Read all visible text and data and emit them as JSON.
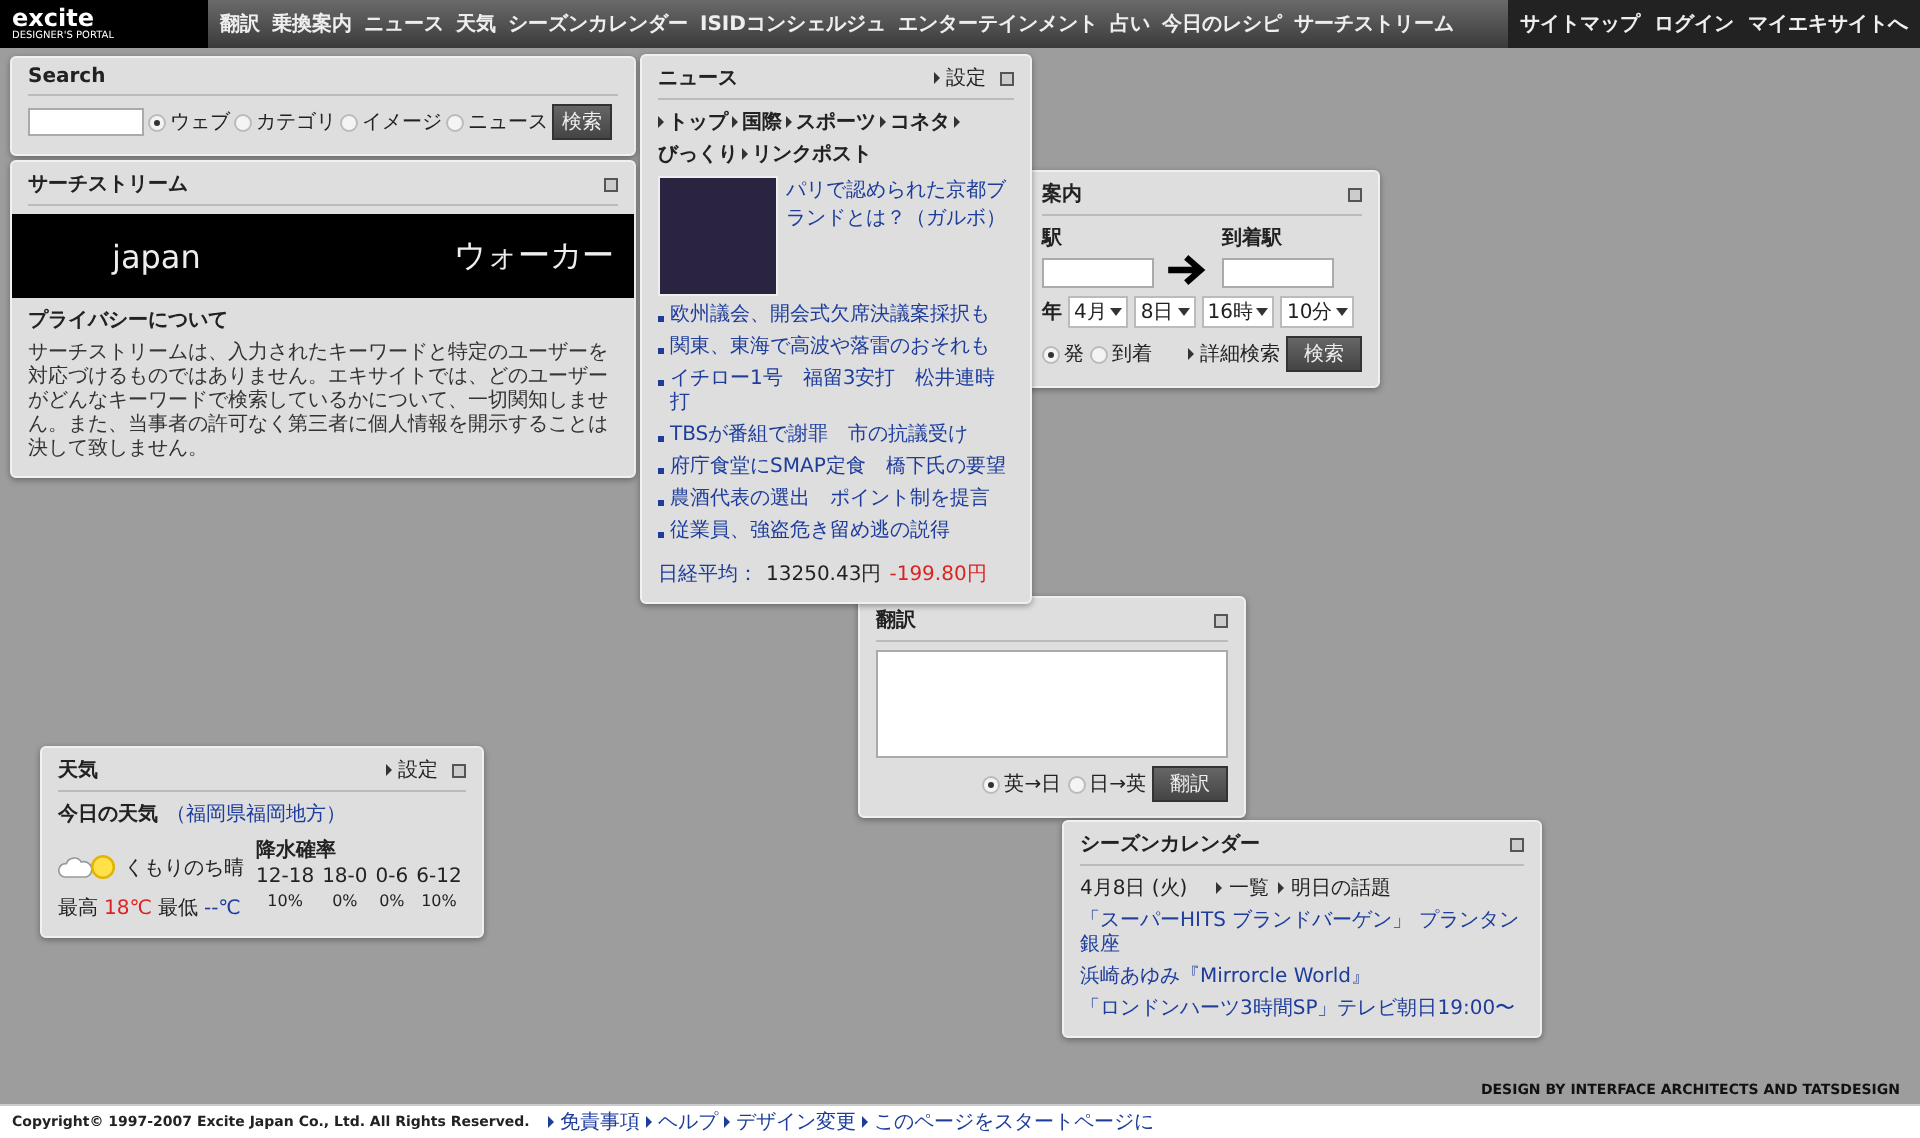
{
  "top_nav": {
    "logo": "excite",
    "logo_sub": "DESIGNER'S PORTAL",
    "items": [
      "翻訳",
      "乗換案内",
      "ニュース",
      "天気",
      "シーズンカレンダー",
      "ISIDコンシェルジュ",
      "エンターテインメント",
      "占い",
      "今日のレシピ",
      "サーチストリーム"
    ],
    "right_items": [
      "サイトマップ",
      "ログイン",
      "マイエキサイトへ"
    ]
  },
  "search": {
    "title": "Search",
    "options": [
      {
        "label": "ウェブ",
        "selected": true
      },
      {
        "label": "カテゴリ",
        "selected": false
      },
      {
        "label": "イメージ",
        "selected": false
      },
      {
        "label": "ニュース",
        "selected": false
      }
    ],
    "button": "検索"
  },
  "search_stream": {
    "title": "サーチストリーム",
    "words": [
      "japan",
      "ウォーカー"
    ],
    "privacy_title": "プライバシーについて",
    "privacy_text": "サーチストリームは、入力されたキーワードと特定のユーザーを対応づけるものではありません。エキサイトでは、どのユーザーがどんなキーワードで検索しているかについて、一切関知しません。また、当事者の許可なく第三者に個人情報を開示することは決して致しません。"
  },
  "news": {
    "title": "ニュース",
    "settings": "設定",
    "tabs": [
      "トップ",
      "国際",
      "スポーツ",
      "コネタ",
      "びっくり",
      "リンクポスト"
    ],
    "feature": "パリで認められた京都ブランドとは？（ガルボ）",
    "headlines": [
      "欧州議会、開会式欠席決議案採択も",
      "関東、東海で高波や落雷のおそれも",
      "イチロー1号　福留3安打　松井連時打",
      "TBSが番組で謝罪　市の抗議受け",
      "府庁食堂にSMAP定食　橋下氏の要望",
      "農酒代表の選出　ポイント制を提言",
      "従業員、強盗危き留め逃の説得"
    ],
    "nikkei_label": "日経平均：",
    "nikkei_value": "13250.43円",
    "nikkei_change": "-199.80円"
  },
  "transit": {
    "title": "案内",
    "from_label": "駅",
    "to_label": "到着駅",
    "date_label": "年",
    "selects": [
      "4月",
      "8日",
      "16時",
      "10分"
    ],
    "options": [
      {
        "label": "発",
        "selected": true
      },
      {
        "label": "到着",
        "selected": false
      }
    ],
    "detail_link": "詳細検索",
    "button": "検索"
  },
  "translate": {
    "title": "翻訳",
    "options": [
      {
        "label": "英→日",
        "selected": true
      },
      {
        "label": "日→英",
        "selected": false
      }
    ],
    "button": "翻訳"
  },
  "weather": {
    "title": "天気",
    "settings": "設定",
    "today_label": "今日の天気",
    "region": "（福岡県福岡地方）",
    "condition": "くもりのち晴",
    "rain_label": "降水確率",
    "periods": [
      "12-18",
      "18-0",
      "0-6",
      "6-12"
    ],
    "chances": [
      "10%",
      "0%",
      "0%",
      "10%"
    ],
    "high_label": "最高",
    "high": "18℃",
    "low_label": "最低",
    "low": "--℃"
  },
  "season": {
    "title": "シーズンカレンダー",
    "date": "4月8日 (火)",
    "links": [
      "一覧",
      "明日の話題"
    ],
    "items": [
      "「スーパーHITS ブランドバーゲン」 プランタン銀座",
      "浜崎あゆみ『Mirrorcle World』",
      "「ロンドンハーツ3時間SP」テレビ朝日19:00〜"
    ]
  },
  "credit": "DESIGN BY INTERFACE ARCHITECTS AND TATSDESIGN",
  "footer": {
    "copyright": "Copyright© 1997-2007 Excite Japan Co., Ltd. All Rights Reserved.",
    "links": [
      "免責事項",
      "ヘルプ",
      "デザイン変更",
      "このページをスタートページに"
    ]
  }
}
